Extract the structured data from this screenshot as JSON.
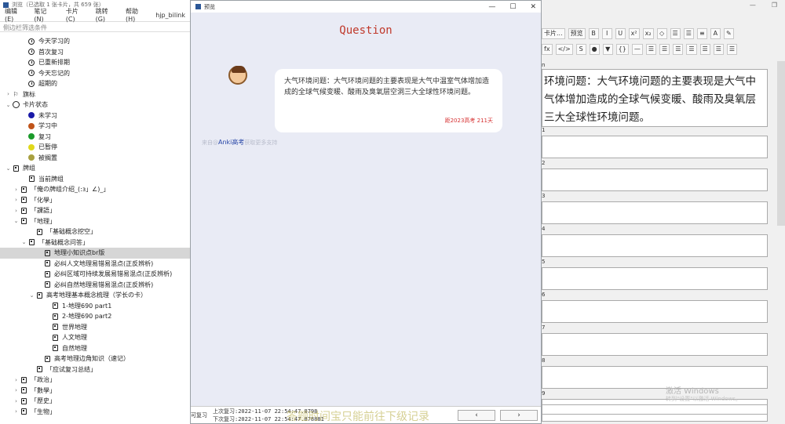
{
  "browser": {
    "title": "浏览（已选取 1 张卡片，共 659 张）",
    "menu": [
      "编辑(E)",
      "笔记 (N)",
      "卡片(C)",
      "跳转(G)",
      "帮助(H)",
      "hjp_bilink"
    ],
    "search_placeholder": "侧边栏筛选条件",
    "tree": [
      {
        "indent": 2,
        "arrow": "",
        "icon": "clock",
        "label": "今天学习的"
      },
      {
        "indent": 2,
        "arrow": "",
        "icon": "clock",
        "label": "首次复习"
      },
      {
        "indent": 2,
        "arrow": "",
        "icon": "clock",
        "label": "已重新排期"
      },
      {
        "indent": 2,
        "arrow": "",
        "icon": "clock",
        "label": "今天忘记的"
      },
      {
        "indent": 2,
        "arrow": "",
        "icon": "clock",
        "label": "超期的"
      },
      {
        "indent": 0,
        "arrow": "›",
        "icon": "flag",
        "label": "旗标"
      },
      {
        "indent": 0,
        "arrow": "⌄",
        "icon": "ring",
        "label": "卡片状态"
      },
      {
        "indent": 2,
        "arrow": "",
        "icon": "dot",
        "color": "#1a1aa8",
        "label": "未学习"
      },
      {
        "indent": 2,
        "arrow": "",
        "icon": "dot",
        "color": "#c0541a",
        "label": "学习中"
      },
      {
        "indent": 2,
        "arrow": "",
        "icon": "dot",
        "color": "#1a9a2a",
        "label": "复习"
      },
      {
        "indent": 2,
        "arrow": "",
        "icon": "dot",
        "color": "#e0d81a",
        "label": "已暂停"
      },
      {
        "indent": 2,
        "arrow": "",
        "icon": "dot",
        "color": "#a8a040",
        "label": "被搁置"
      },
      {
        "indent": 0,
        "arrow": "⌄",
        "icon": "deck",
        "label": "牌组"
      },
      {
        "indent": 2,
        "arrow": "",
        "icon": "deck",
        "label": "当前牌组"
      },
      {
        "indent": 1,
        "arrow": "›",
        "icon": "deck",
        "label": "「俺の牌组介绍_(:з」∠)_」"
      },
      {
        "indent": 1,
        "arrow": "›",
        "icon": "deck",
        "label": "「化學」"
      },
      {
        "indent": 1,
        "arrow": "›",
        "icon": "deck",
        "label": "「課語」"
      },
      {
        "indent": 1,
        "arrow": "⌄",
        "icon": "deck",
        "label": "「地理」"
      },
      {
        "indent": 3,
        "arrow": "",
        "icon": "deck",
        "label": "「基础概念挖空」"
      },
      {
        "indent": 2,
        "arrow": "⌄",
        "icon": "deck",
        "label": "「基础概念问答」"
      },
      {
        "indent": 4,
        "arrow": "",
        "icon": "deck",
        "label": "地理小知识点br版",
        "selected": true
      },
      {
        "indent": 4,
        "arrow": "",
        "icon": "deck",
        "label": "必纠人文地理易错易混点(正反辨析)"
      },
      {
        "indent": 4,
        "arrow": "",
        "icon": "deck",
        "label": "必纠区域可持续发展易错易混点(正反辨析)"
      },
      {
        "indent": 4,
        "arrow": "",
        "icon": "deck",
        "label": "必纠自然地理易错易混点(正反辨析)"
      },
      {
        "indent": 3,
        "arrow": "⌄",
        "icon": "deck",
        "label": "高考地理基本概念梳理（学长の卡）"
      },
      {
        "indent": 5,
        "arrow": "",
        "icon": "deck",
        "label": "1-地理690 part1"
      },
      {
        "indent": 5,
        "arrow": "",
        "icon": "deck",
        "label": "2-地理690 part2"
      },
      {
        "indent": 5,
        "arrow": "",
        "icon": "deck",
        "label": "世界地理"
      },
      {
        "indent": 5,
        "arrow": "",
        "icon": "deck",
        "label": "人文地理"
      },
      {
        "indent": 5,
        "arrow": "",
        "icon": "deck",
        "label": "自然地理"
      },
      {
        "indent": 4,
        "arrow": "",
        "icon": "deck",
        "label": "高考地理边角知识（速记）"
      },
      {
        "indent": 3,
        "arrow": "",
        "icon": "deck",
        "label": "「应试复习总结」"
      },
      {
        "indent": 1,
        "arrow": "›",
        "icon": "deck",
        "label": "「政治」"
      },
      {
        "indent": 1,
        "arrow": "›",
        "icon": "deck",
        "label": "「數學」"
      },
      {
        "indent": 1,
        "arrow": "›",
        "icon": "deck",
        "label": "「歷史」"
      },
      {
        "indent": 1,
        "arrow": "›",
        "icon": "deck",
        "label": "「生物」"
      }
    ]
  },
  "preview": {
    "title": "预览",
    "heading": "Question",
    "question": "大气环境问题：大气环境问题的主要表现是大气中温室气体增加造成的全球气候变暖、酸雨及臭氧层空洞三大全球性环境问题。",
    "countdown": "距2023高考 211天",
    "faint_prefix": "来自@",
    "faint_link": "Anki高考",
    "faint_suffix": "获取更多支持",
    "bottom_label": "可复习",
    "last_review": "上次复习:2022-11-07 22:54:47.8798",
    "next_review": "下次复习:2022-11-07 22:54:47.878881",
    "overlay_text": "答题时间宝只能前往下级记录",
    "prev_btn": "‹",
    "next_btn": "›",
    "window_controls": [
      "—",
      "☐",
      "✕"
    ]
  },
  "editor": {
    "window_controls": [
      "—",
      "❐"
    ],
    "toolbar1": [
      "卡片...",
      "预览",
      "B",
      "I",
      "U",
      "x²",
      "x₂",
      "◇",
      "☰",
      "☰",
      "≡",
      "A",
      "✎"
    ],
    "toolbar2": [
      "fx",
      "</>",
      "S",
      "●",
      "▼",
      "{}",
      "—",
      "☰",
      "☰",
      "☰",
      "☰",
      "☰",
      "☰",
      "☰"
    ],
    "field_label_top": "n",
    "field_main": "环境问题：大气环境问题的主要表现是大气中气体增加造成的全球气候变暖、酸雨及臭氧层三大全球性环境问题。",
    "field_labels": [
      "1",
      "2",
      "3",
      "4",
      "5",
      "6",
      "7",
      "8",
      "9"
    ],
    "watermark": "激活 Windows",
    "watermark_sub": "转到\"设置\"以激活 Windows。"
  }
}
